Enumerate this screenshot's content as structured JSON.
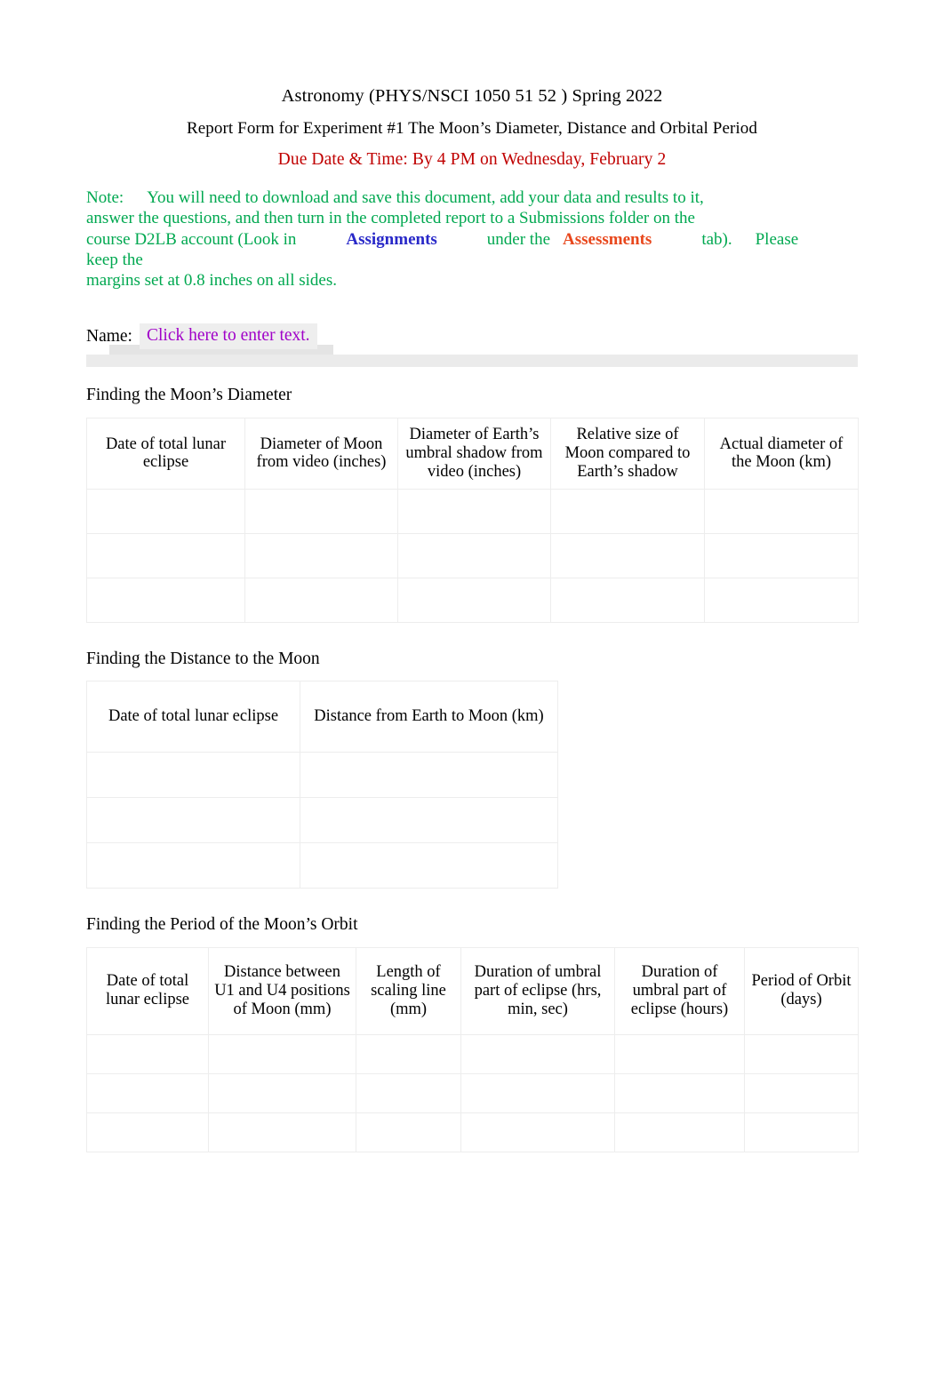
{
  "document": {
    "title_course": "Astronomy (PHYS/NSCI 1050 51 52 )",
    "title_term": "Spring 2022",
    "title_subtitle": "Report Form for Experiment #1 The Moon’s Diameter, Distance and Orbital Period",
    "due_notice": "Due Date & Time: By 4 PM on Wednesday, February 2"
  },
  "note": {
    "label": "Note:",
    "line1": "You will need to download and save this document, add your data and results to it,",
    "line2": "answer the questions, and then turn in the completed report to a Submissions folder on the",
    "line3_a": "course D2LB account (Look in",
    "link_assignments": "Assignments",
    "line3_b": "under the",
    "link_assessments": "Assessments",
    "line3_c": "tab).",
    "line3_d": "Please keep the",
    "line4": "margins set at 0.8 inches on all sides."
  },
  "name_field": {
    "label": "Name:",
    "placeholder": "Click here to enter text."
  },
  "sections": [
    {
      "heading": "Finding the Moon’s Diameter",
      "table": {
        "headers": [
          "Date of total lunar eclipse",
          "Diameter of Moon from video (inches)",
          "Diameter of Earth’s umbral shadow from video (inches)",
          "Relative size of Moon compared to Earth’s shadow",
          "Actual diameter of the Moon (km)"
        ],
        "rows": [
          [
            "",
            "",
            "",
            "",
            ""
          ],
          [
            "",
            "",
            "",
            "",
            ""
          ],
          [
            "",
            "",
            "",
            "",
            ""
          ]
        ]
      }
    },
    {
      "heading": "Finding the Distance to the Moon",
      "table": {
        "headers": [
          "Date of total lunar eclipse",
          "Distance from Earth to Moon (km)"
        ],
        "rows": [
          [
            "",
            ""
          ],
          [
            "",
            ""
          ],
          [
            "",
            ""
          ]
        ]
      }
    },
    {
      "heading": "Finding the Period of the Moon’s Orbit",
      "table": {
        "headers": [
          "Date of total lunar eclipse",
          "Distance between U1 and U4 positions of Moon (mm)",
          "Length of scaling line (mm)",
          "Duration of umbral part of eclipse (hrs, min, sec)",
          "Duration of umbral part of eclipse (hours)",
          "Period of Orbit (days)"
        ],
        "rows": [
          [
            "",
            "",
            "",
            "",
            "",
            ""
          ],
          [
            "",
            "",
            "",
            "",
            "",
            ""
          ],
          [
            "",
            "",
            "",
            "",
            "",
            ""
          ]
        ]
      }
    }
  ],
  "colors": {
    "due_red": "#c00000",
    "note_green": "#00a850",
    "assignments_blue": "#2828c8",
    "assessments_orange": "#e8471c",
    "placeholder_purple": "#a000c8"
  }
}
